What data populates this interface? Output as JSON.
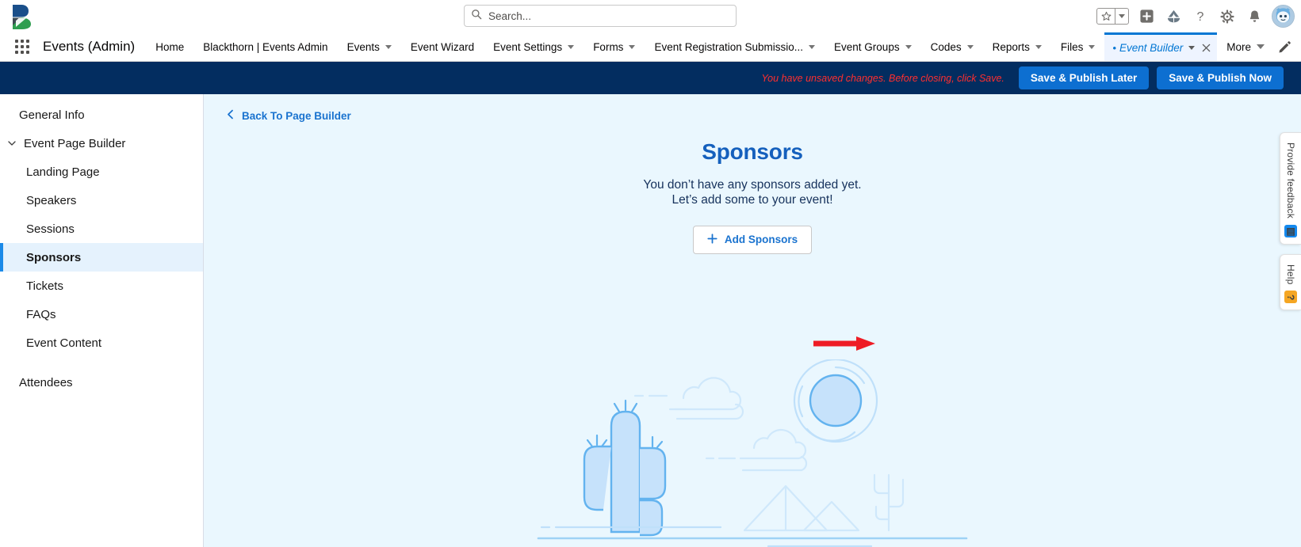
{
  "global_header": {
    "logo_name": "blackthorn-logo",
    "search": {
      "placeholder": "Search...",
      "value": ""
    },
    "icons": [
      {
        "name": "favorites-star-icon",
        "label": "Favorites"
      },
      {
        "name": "favorites-dropdown-icon",
        "label": "Favorites list"
      },
      {
        "name": "add-icon",
        "label": "Add"
      },
      {
        "name": "cloud-icon",
        "label": "Cloud"
      },
      {
        "name": "help-icon",
        "label": "Help"
      },
      {
        "name": "setup-gear-icon",
        "label": "Setup"
      },
      {
        "name": "notifications-bell-icon",
        "label": "Notifications"
      },
      {
        "name": "user-avatar",
        "label": "User profile"
      }
    ]
  },
  "app_nav": {
    "app_launcher_label": "App Launcher",
    "app_name": "Events (Admin)",
    "items": [
      {
        "label": "Home",
        "has_menu": false,
        "active": false
      },
      {
        "label": "Blackthorn | Events Admin",
        "has_menu": false,
        "active": false
      },
      {
        "label": "Events",
        "has_menu": true,
        "active": false
      },
      {
        "label": "Event Wizard",
        "has_menu": false,
        "active": false
      },
      {
        "label": "Event Settings",
        "has_menu": true,
        "active": false
      },
      {
        "label": "Forms",
        "has_menu": true,
        "active": false
      },
      {
        "label": "Event Registration Submissio...",
        "has_menu": true,
        "active": false
      },
      {
        "label": "Event Groups",
        "has_menu": true,
        "active": false
      },
      {
        "label": "Codes",
        "has_menu": true,
        "active": false
      },
      {
        "label": "Reports",
        "has_menu": true,
        "active": false
      },
      {
        "label": "Files",
        "has_menu": true,
        "active": false
      }
    ],
    "active_tab": {
      "label": "Event Builder",
      "unsaved_marker": "•",
      "has_menu": true,
      "closable": true
    },
    "more_label": "More",
    "edit_pencil_name": "edit-nav-pencil-icon"
  },
  "notice_bar": {
    "message": "You have unsaved changes. Before closing, click Save.",
    "message_color": "#ff2e2e",
    "background": "#032d60",
    "save_later_label": "Save & Publish Later",
    "save_now_label": "Save & Publish Now",
    "button_color": "#0d6fd1"
  },
  "sidebar": {
    "items": [
      {
        "label": "General Info",
        "type": "item",
        "active": false
      },
      {
        "label": "Event Page Builder",
        "type": "group",
        "expanded": true,
        "active": false
      },
      {
        "label": "Landing Page",
        "type": "sub",
        "active": false
      },
      {
        "label": "Speakers",
        "type": "sub",
        "active": false
      },
      {
        "label": "Sessions",
        "type": "sub",
        "active": false
      },
      {
        "label": "Sponsors",
        "type": "sub",
        "active": true
      },
      {
        "label": "Tickets",
        "type": "sub",
        "active": false
      },
      {
        "label": "FAQs",
        "type": "sub",
        "active": false
      },
      {
        "label": "Event Content",
        "type": "sub",
        "active": false
      },
      {
        "label": "Attendees",
        "type": "item",
        "active": false
      }
    ],
    "active_accent": "#1b8ae8",
    "active_background": "#e5f2fd"
  },
  "main": {
    "back_link": "Back To Page Builder",
    "title": "Sponsors",
    "title_color": "#1560bd",
    "subtitle_line1": "You don’t have any sponsors added yet.",
    "subtitle_line2": "Let’s add some to your event!",
    "add_button_label": "Add Sponsors",
    "add_button_icon": "plus-icon",
    "annotation": {
      "name": "red-arrow-annotation",
      "color": "#ee1c25",
      "direction": "right"
    },
    "illustration": {
      "name": "desert-empty-state-illustration",
      "elements": [
        "cactus",
        "clouds",
        "sun",
        "mountains",
        "ground-line"
      ]
    },
    "background": "#eaf7fe"
  },
  "edge_tabs": [
    {
      "label": "Provide feedback",
      "icon_name": "feedback-icon",
      "icon_color": "#1589ee",
      "icon_glyph": "▤"
    },
    {
      "label": "Help",
      "icon_name": "help-widget-icon",
      "icon_color": "#f5a623",
      "icon_glyph": "?"
    }
  ]
}
